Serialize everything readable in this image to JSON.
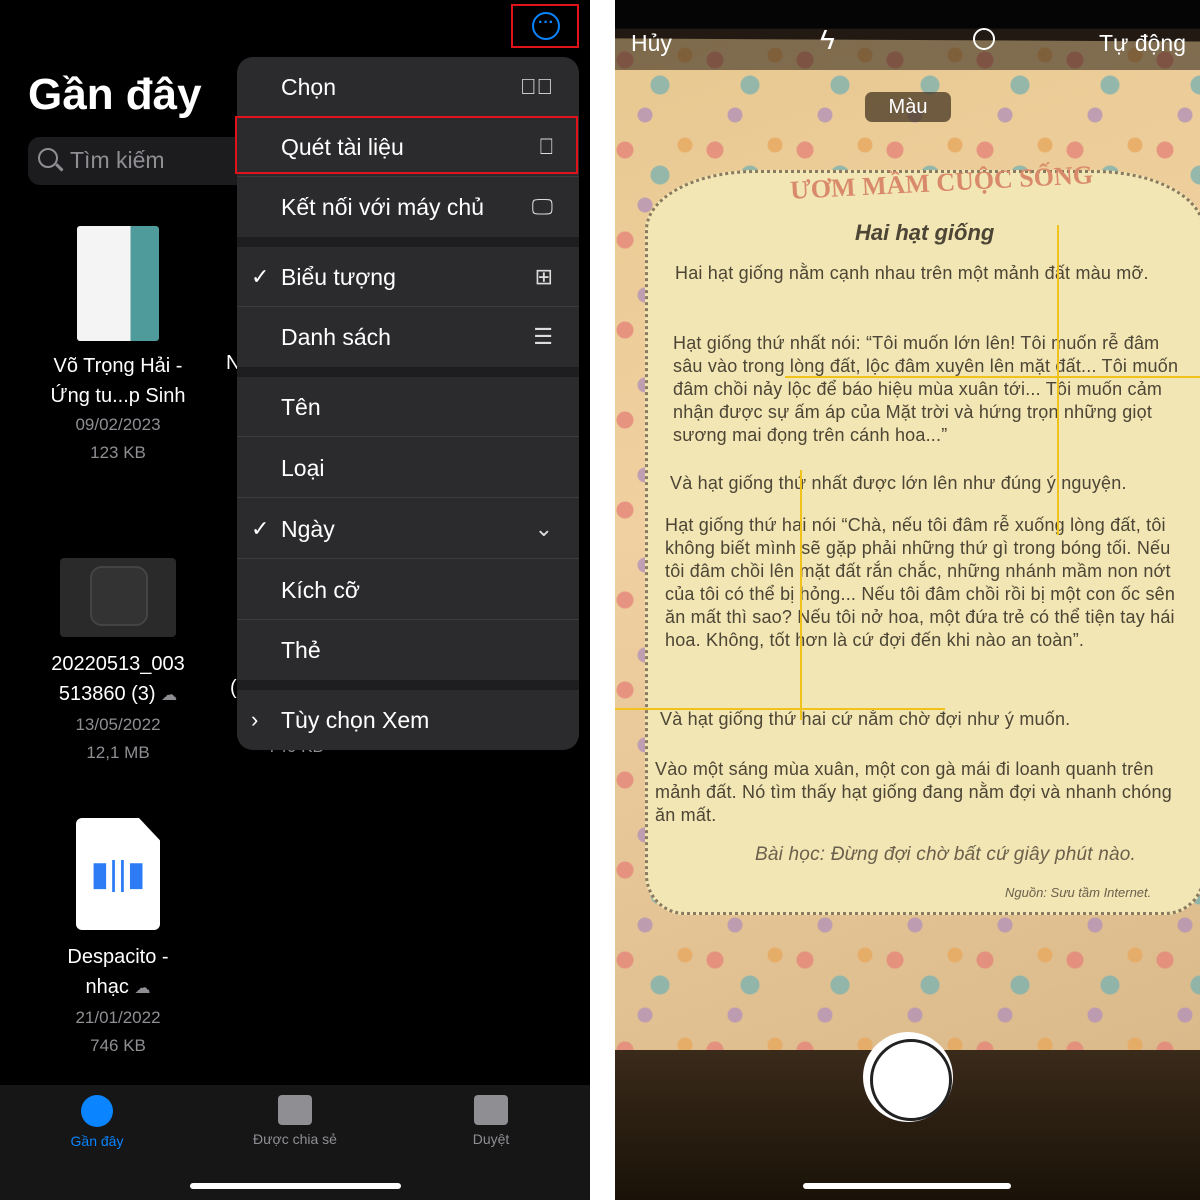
{
  "left": {
    "title": "Gần đây",
    "search_placeholder": "Tìm kiếm",
    "more_icon": "ellipsis-circle-icon",
    "menu": [
      {
        "label": "Chọn",
        "icon": "checkmark-circle-icon",
        "checked": false
      },
      {
        "label": "Quét tài liệu",
        "icon": "doc-scan-icon",
        "checked": false,
        "highlighted": true
      },
      {
        "label": "Kết nối với máy chủ",
        "icon": "monitor-icon",
        "checked": false
      },
      {
        "label": "Biểu tượng",
        "icon": "grid-icon",
        "checked": true
      },
      {
        "label": "Danh sách",
        "icon": "list-icon",
        "checked": false
      },
      {
        "label": "Tên",
        "checked": false
      },
      {
        "label": "Loại",
        "checked": false
      },
      {
        "label": "Ngày",
        "icon": "chevron-down-icon",
        "checked": true
      },
      {
        "label": "Kích cỡ",
        "checked": false
      },
      {
        "label": "Thẻ",
        "checked": false
      },
      {
        "label": "Tùy chọn Xem",
        "icon": "chevron-right-icon",
        "checked": false
      }
    ],
    "files": [
      {
        "name1": "Võ Trọng Hải -",
        "name2": "Ứng tu...p Sinh",
        "date": "09/02/2023",
        "size": "123 KB"
      },
      {
        "name1": "20220513_003",
        "name2": "513860 (3)",
        "date": "13/05/2022",
        "size": "12,1 MB",
        "cloud": true
      },
      {
        "name1": "Despacito -",
        "name2": "nhạc",
        "date": "21/01/2022",
        "size": "746 KB",
        "cloud": true
      }
    ],
    "partial": {
      "a": "N",
      "b": "(",
      "c": "740 KB"
    },
    "tabs": [
      {
        "label": "Gần đây",
        "icon": "clock-icon",
        "active": true
      },
      {
        "label": "Được chia sẻ",
        "icon": "shared-folder-icon",
        "active": false
      },
      {
        "label": "Duyệt",
        "icon": "folder-icon",
        "active": false
      }
    ]
  },
  "right": {
    "cancel": "Hủy",
    "auto": "Tự động",
    "color_mode": "Màu",
    "flash_icon": "flash-icon",
    "filter_icon": "filters-icon",
    "doc": {
      "header": "ƯƠM MẦM CUỘC SỐNG",
      "title": "Hai hạt giống",
      "p1": "Hai hạt giống nằm cạnh nhau trên một mảnh đất màu mỡ.",
      "p2": "Hạt giống thứ nhất nói: “Tôi muốn lớn lên! Tôi muốn rễ đâm sâu vào trong lòng đất, lộc đâm xuyên lên mặt đất... Tôi muốn đâm chồi nảy lộc để báo hiệu mùa xuân tới... Tôi muốn cảm nhận được sự ấm áp của Mặt trời và hứng trọn những giọt sương mai đọng trên cánh hoa...”",
      "p3": "Và hạt giống thứ nhất được lớn lên như đúng ý nguyện.",
      "p4": "Hạt giống thứ hai nói “Chà, nếu tôi đâm rễ xuống lòng đất, tôi không biết mình sẽ gặp phải những thứ gì trong bóng tối. Nếu tôi đâm chồi lên mặt đất rắn chắc, những nhánh mầm non nớt của tôi có thể bị hỏng... Nếu tôi đâm chồi rồi bị một con ốc sên ăn mất thì sao? Nếu tôi nở hoa, một đứa trẻ có thể tiện tay hái hoa. Không, tốt hơn là cứ đợi đến khi nào an toàn”.",
      "p5": "Và hạt giống thứ hai cứ nằm chờ đợi như ý muốn.",
      "p6": "Vào một sáng mùa xuân, một con gà mái đi loanh quanh trên mảnh đất. Nó tìm thấy hạt giống đang nằm đợi và nhanh chóng ăn mất.",
      "lesson": "Bài học: Đừng đợi chờ bất cứ giây phút nào.",
      "source": "Nguồn: Sưu tầm Internet."
    }
  },
  "colors": {
    "accent": "#0a84ff",
    "highlight_box": "#e0131a",
    "detect_lines": "#f1c21b"
  }
}
